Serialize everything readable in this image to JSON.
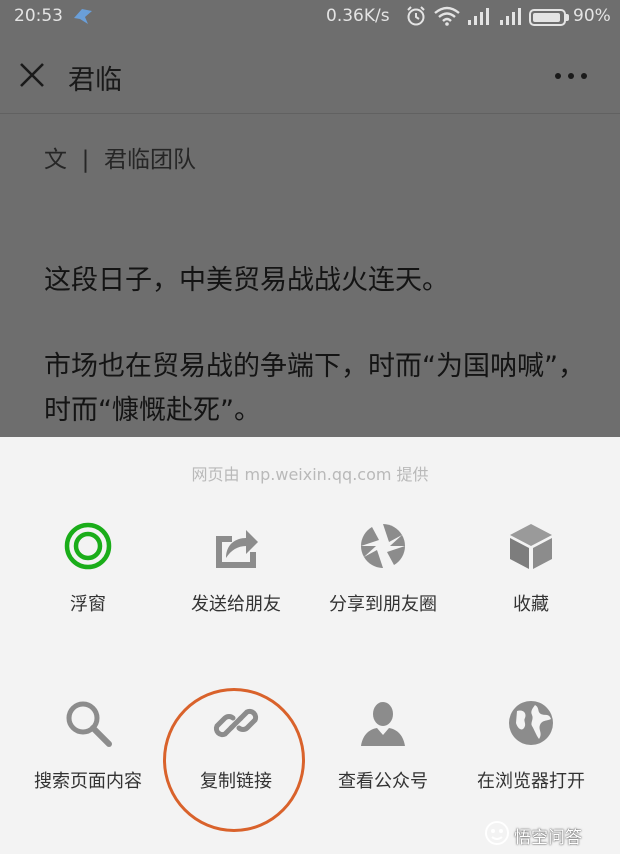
{
  "status_bar": {
    "time": "20:53",
    "network_speed": "0.36K/s",
    "battery_percent": "90%",
    "icons": [
      "app-notification-icon",
      "alarm-icon",
      "wifi-icon",
      "signal-icon",
      "signal-icon",
      "battery-icon"
    ]
  },
  "title_bar": {
    "title": "君临",
    "close_icon": "close-icon",
    "more_icon": "more-dots-icon"
  },
  "article": {
    "author_line": "文  |  君临团队",
    "paragraph_1": "这段日子，中美贸易战战火连天。",
    "paragraph_2": "市场也在贸易战的争端下，时而“为国呐喊”，时而“慷慨赴死”。"
  },
  "share_sheet": {
    "provider": "网页由 mp.weixin.qq.com 提供",
    "row_1": [
      {
        "label": "浮窗",
        "icon": "floating-window-icon"
      },
      {
        "label": "发送给朋友",
        "icon": "send-share-icon"
      },
      {
        "label": "分享到朋友圈",
        "icon": "moments-shutter-icon"
      },
      {
        "label": "收藏",
        "icon": "favorite-cube-icon"
      }
    ],
    "row_2": [
      {
        "label": "搜索页面内容",
        "icon": "search-icon"
      },
      {
        "label": "复制链接",
        "icon": "link-icon"
      },
      {
        "label": "查看公众号",
        "icon": "person-icon"
      },
      {
        "label": "在浏览器打开",
        "icon": "globe-icon"
      }
    ]
  },
  "watermark": {
    "text": "悟空问答"
  },
  "colors": {
    "dim_overlay": "#6e6e6e",
    "sheet_background": "#f3f3f3",
    "float_icon_green": "#1aad19",
    "icon_gray": "#8c8c8c",
    "highlight_orange": "#d9622b"
  }
}
